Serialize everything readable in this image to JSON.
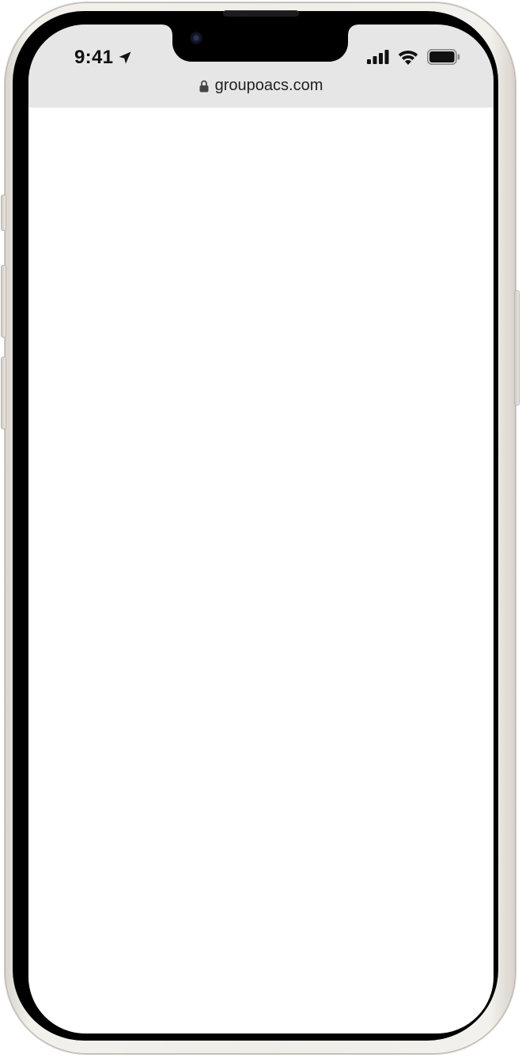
{
  "device": {
    "frame_color": "#efede8",
    "bezel_color": "#000000"
  },
  "status_bar": {
    "time": "9:41",
    "location_icon": "location-arrow-icon",
    "signal_icon": "cellular-signal-icon",
    "wifi_icon": "wifi-icon",
    "battery_icon": "battery-icon"
  },
  "browser": {
    "chrome_color": "#e6e6e6",
    "lock_icon": "lock-icon",
    "url": "groupoacs.com"
  }
}
